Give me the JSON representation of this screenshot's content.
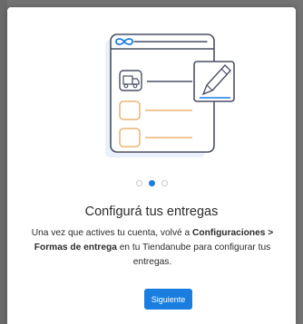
{
  "modal": {
    "title": "Configurá tus entregas",
    "body": {
      "prefix": "Una vez que actives tu cuenta, volvé a ",
      "bold": "Configuraciones > Formas de entrega",
      "suffix": " en tu Tiendanube para configurar tus entregas."
    },
    "button_label": "Siguiente",
    "pager": {
      "total": 3,
      "current": 2
    }
  },
  "colors": {
    "accent": "#1a7de0",
    "backdrop": "#737373",
    "title_text": "#2b2b2b"
  },
  "illustration": {
    "icons": [
      "infinity-icon",
      "truck-icon",
      "pencil-icon"
    ]
  }
}
